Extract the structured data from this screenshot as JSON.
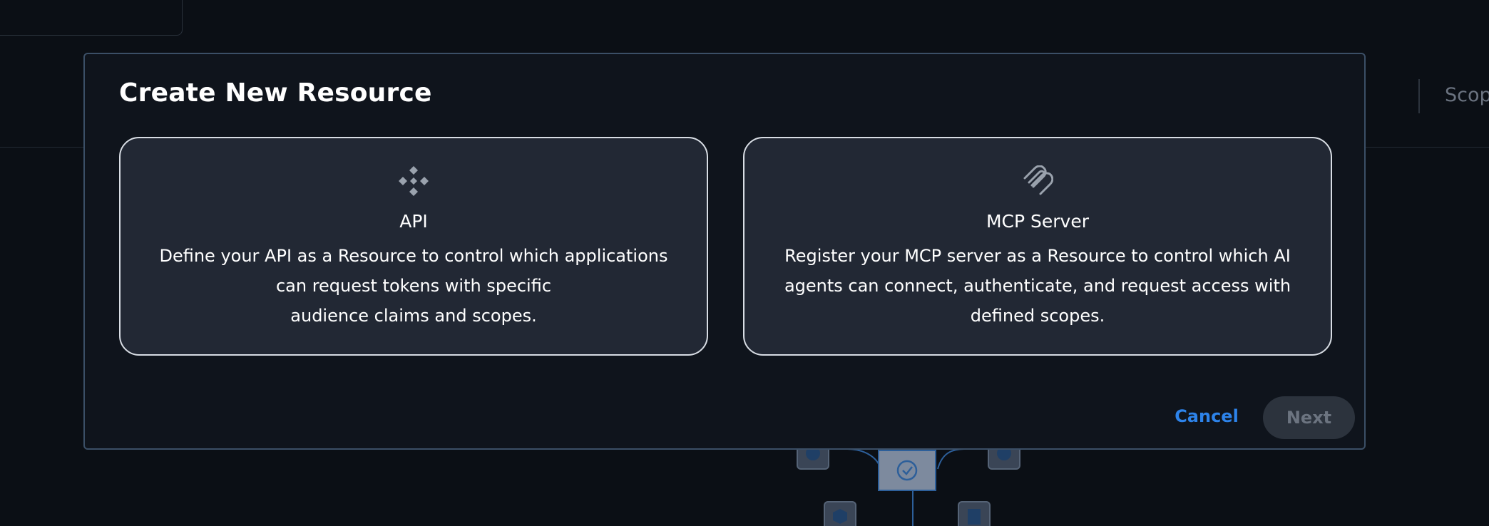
{
  "background": {
    "tab_partial_label": "Scop"
  },
  "modal": {
    "title": "Create New Resource",
    "cards": [
      {
        "label": "API",
        "icon": "api-diamond-icon",
        "description_lines": [
          "Define your API as a Resource to control which applications",
          "can request tokens with specific",
          "audience claims and scopes."
        ]
      },
      {
        "label": "MCP Server",
        "icon": "mcp-link-icon",
        "description_lines": [
          "Register your MCP server as a Resource to control which AI",
          "agents can connect, authenticate, and request access with",
          "defined scopes."
        ]
      }
    ],
    "cancel_label": "Cancel",
    "next_label": "Next"
  },
  "colors": {
    "background": "#0b0f15",
    "modal": "#0f141c",
    "card": "#222834",
    "accent": "#2d83ea",
    "disabled_button": "#2c333d"
  }
}
